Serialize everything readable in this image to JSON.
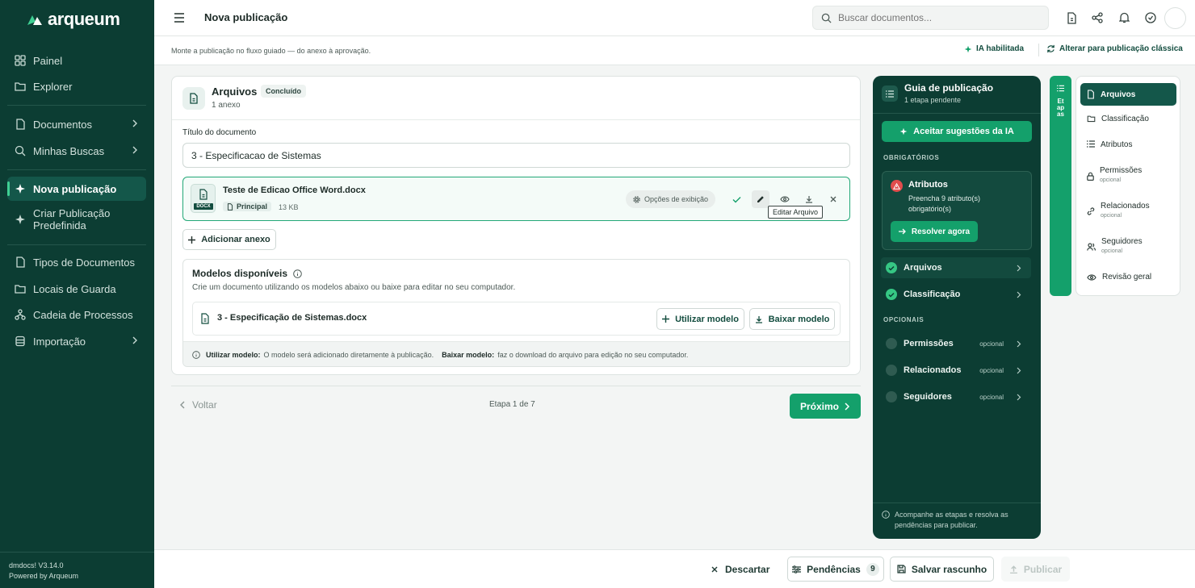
{
  "brand": {
    "name": "arqueum",
    "accent": "#14a06b",
    "sidebar_bg": "#0c3d33"
  },
  "sidebar": {
    "items": [
      {
        "label": "Painel",
        "icon": "grid-icon"
      },
      {
        "label": "Explorer",
        "icon": "folder-icon"
      },
      {
        "label": "Documentos",
        "icon": "document-icon"
      },
      {
        "label": "Minhas Buscas",
        "icon": "search-icon"
      },
      {
        "label": "Nova publicação",
        "icon": "sparkle-icon"
      },
      {
        "label": "Criar Publicação Predefinida",
        "icon": "sparkle-icon"
      },
      {
        "label": "Tipos de Documentos",
        "icon": "document-icon"
      },
      {
        "label": "Locais de Guarda",
        "icon": "folder-icon"
      },
      {
        "label": "Cadeia de Processos",
        "icon": "workflow-icon"
      },
      {
        "label": "Importação",
        "icon": "database-icon"
      }
    ],
    "version": "dmdocs! V3.14.0",
    "powered": "Powered by Arqueum"
  },
  "header": {
    "title": "Nova publicação",
    "search_placeholder": "Buscar documentos..."
  },
  "subheader": {
    "description": "Monte a publicação no fluxo guiado — do anexo à aprovação.",
    "ai_badge": "IA habilitada",
    "classic_link": "Alterar para publicação clássica"
  },
  "files_card": {
    "title": "Arquivos",
    "status": "Concluído",
    "count": "1 anexo",
    "doc_title_label": "Título do documento",
    "doc_title_value": "3 - Especificacao de Sistemas",
    "file": {
      "name": "Teste de Edicao Office Word.docx",
      "ext": "DOCX",
      "tag": "Principal",
      "size": "13 KB",
      "display_options": "Opções de exibição",
      "tooltip": "Editar Arquivo"
    },
    "add_attachment": "Adicionar anexo"
  },
  "models": {
    "title": "Modelos disponíveis",
    "description": "Crie um documento utilizando os modelos abaixo ou baixe para editar no seu computador.",
    "model_name": "3 - Especificação de Sistemas.docx",
    "use_button": "Utilizar modelo",
    "download_button": "Baixar modelo",
    "help_use_label": "Utilizar modelo:",
    "help_use_text": "O modelo será adicionado diretamente à publicação.",
    "help_download_label": "Baixar modelo:",
    "help_download_text": "faz o download do arquivo para edição no seu computador."
  },
  "pager": {
    "back": "Voltar",
    "step": "Etapa 1 de 7",
    "next": "Próximo"
  },
  "guide": {
    "title": "Guia de publicação",
    "subtitle": "1 etapa pendente",
    "ai_button": "Aceitar sugestões da IA",
    "required_label": "OBRIGATÓRIOS",
    "alert_title": "Atributos",
    "alert_text": "Preencha 9 atributo(s) obrigatório(s)",
    "resolve_button": "Resolver agora",
    "required_items": [
      "Arquivos",
      "Classificação"
    ],
    "optional_label": "OPCIONAIS",
    "optional_items": [
      "Permissões",
      "Relacionados",
      "Seguidores"
    ],
    "optional_tag": "opcional",
    "footer_note": "Acompanhe as etapas e resolva as pendências para publicar."
  },
  "steps": {
    "strip_label": "Etapas",
    "items": [
      {
        "label": "Arquivos",
        "sub": ""
      },
      {
        "label": "Classificação",
        "sub": ""
      },
      {
        "label": "Atributos",
        "sub": ""
      },
      {
        "label": "Permissões",
        "sub": "opcional"
      },
      {
        "label": "Relacionados",
        "sub": "opcional"
      },
      {
        "label": "Seguidores",
        "sub": "opcional"
      },
      {
        "label": "Revisão geral",
        "sub": ""
      }
    ]
  },
  "footer": {
    "discard": "Descartar",
    "pending": "Pendências",
    "pending_count": "9",
    "save_draft": "Salvar rascunho",
    "publish": "Publicar"
  }
}
